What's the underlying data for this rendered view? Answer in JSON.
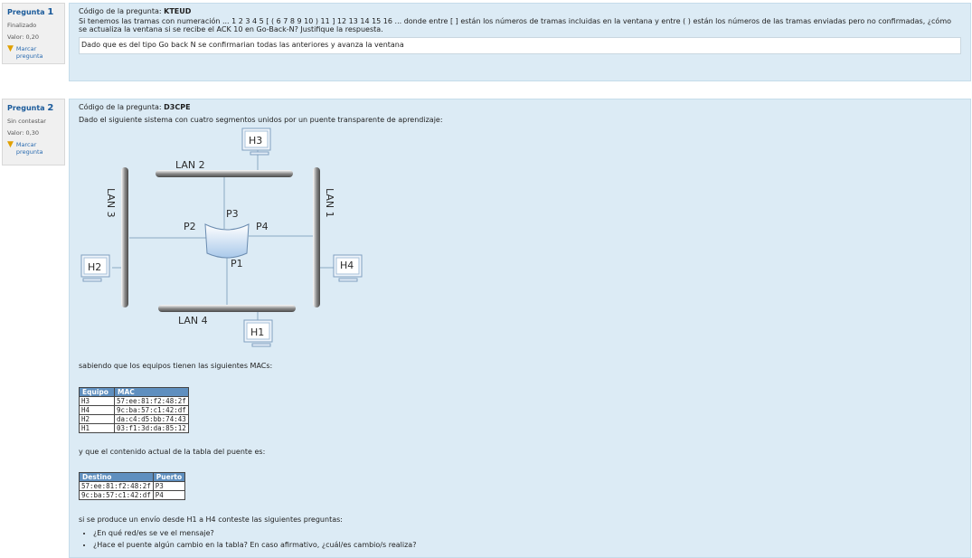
{
  "q1": {
    "label": "Pregunta",
    "number": "1",
    "status": "Finalizado",
    "value": "Valor: 0,20",
    "flag_label": "Marcar pregunta",
    "code_label": "Código de la pregunta:",
    "code": "KTEUD",
    "text": "Si tenemos las tramas con numeración ... 1 2 3 4 5 [ ( 6 7 8 9 10 ) 11 ] 12 13 14 15 16 ... donde entre [ ] están los números de tramas incluidas en la ventana y entre ( ) están los números de las tramas enviadas pero no confirmadas, ¿cómo se actualiza la ventana si se recibe el ACK 10 en Go-Back-N? Justifique la respuesta.",
    "answer": "Dado que es del tipo Go back N se confirmarian todas las anteriores y avanza la ventana"
  },
  "q2": {
    "label": "Pregunta",
    "number": "2",
    "status": "Sin contestar",
    "value": "Valor: 0,30",
    "flag_label": "Marcar pregunta",
    "code_label": "Código de la pregunta:",
    "code": "D3CPE",
    "intro": "Dado el siguiente sistema con cuatro segmentos unidos por un puente transparente de aprendizaje:",
    "diagram": {
      "lan1": "LAN 1",
      "lan2": "LAN 2",
      "lan3": "LAN 3",
      "lan4": "LAN 4",
      "p1": "P1",
      "p2": "P2",
      "p3": "P3",
      "p4": "P4",
      "h1": "H1",
      "h2": "H2",
      "h3": "H3",
      "h4": "H4"
    },
    "macs_intro": "sabiendo que los equipos tienen las siguientes MACs:",
    "mac_table": {
      "headers": [
        "Equipo",
        "MAC"
      ],
      "rows": [
        [
          "H3",
          "57:ee:81:f2:48:2f"
        ],
        [
          "H4",
          "9c:ba:57:c1:42:df"
        ],
        [
          "H2",
          "da:c4:d5:bb:74:43"
        ],
        [
          "H1",
          "03:f1:3d:da:85:12"
        ]
      ]
    },
    "bridge_intro": "y que el contenido actual de la tabla del puente es:",
    "bridge_table": {
      "headers": [
        "Destino",
        "Puerto"
      ],
      "rows": [
        [
          "57:ee:81:f2:48:2f",
          "P3"
        ],
        [
          "9c:ba:57:c1:42:df",
          "P4"
        ]
      ]
    },
    "questions_intro": "si se produce un envío desde H1 a H4 conteste las siguientes preguntas:",
    "questions": [
      "¿En qué red/es se ve el mensaje?",
      "¿Hace el puente algún cambio en la tabla? En caso afirmativo, ¿cuál/es cambio/s realiza?"
    ]
  }
}
